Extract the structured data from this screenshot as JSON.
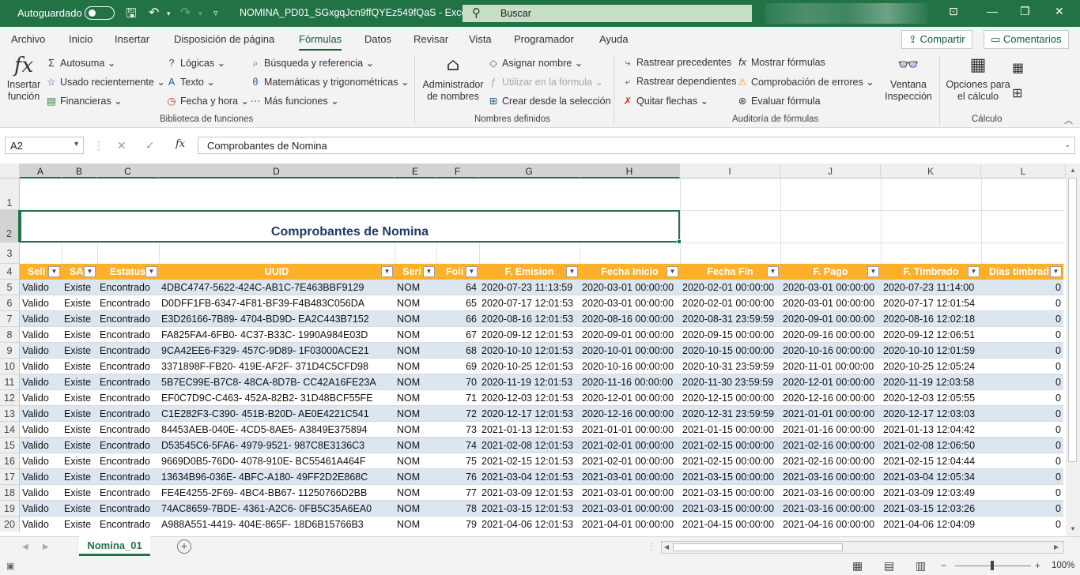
{
  "titlebar": {
    "autosave_label": "Autoguardado",
    "doc_title": "NOMINA_PD01_SGxgqJcn9ffQYEz549fQaS  -  Excel",
    "search_label": "Buscar"
  },
  "menu": {
    "items": [
      "Archivo",
      "Inicio",
      "Insertar",
      "Disposición de página",
      "Fórmulas",
      "Datos",
      "Revisar",
      "Vista",
      "Programador",
      "Ayuda"
    ],
    "active": "Fórmulas",
    "share": "Compartir",
    "comments": "Comentarios"
  },
  "ribbon": {
    "insert_function": "Insertar función",
    "autosum": "Autosuma",
    "recent": "Usado recientemente",
    "financial": "Financieras",
    "logical": "Lógicas",
    "text": "Texto",
    "datetime": "Fecha y hora",
    "lookup": "Búsqueda y referencia",
    "math": "Matemáticas y trigonométricas",
    "more": "Más funciones",
    "group1": "Biblioteca de funciones",
    "name_manager": "Administrador de nombres",
    "define_name": "Asignar nombre",
    "use_in_formula": "Utilizar en la fórmula",
    "create_from_sel": "Crear desde la selección",
    "group2": "Nombres definidos",
    "trace_prec": "Rastrear precedentes",
    "trace_dep": "Rastrear dependientes",
    "remove_arrows": "Quitar flechas",
    "show_formulas": "Mostrar fórmulas",
    "error_check": "Comprobación de errores",
    "evaluate": "Evaluar fórmula",
    "group3": "Auditoría de fórmulas",
    "watch": "Ventana Inspección",
    "calc_options": "Opciones para el cálculo",
    "group4": "Cálculo"
  },
  "formula_bar": {
    "name_box": "A2",
    "formula": "Comprobantes de Nomina"
  },
  "sheet": {
    "columns": [
      "A",
      "B",
      "C",
      "D",
      "E",
      "F",
      "G",
      "H",
      "I",
      "J",
      "K",
      "L"
    ],
    "title": "Comprobantes de Nomina",
    "headers": [
      "Sell",
      "SA",
      "Estatus",
      "UUID",
      "Seri",
      "Foli",
      "F. Emision",
      "Fecha Inicio",
      "Fecha Fin",
      "F. Pago",
      "F. Timbrado",
      "Días timbrad"
    ],
    "rows": [
      {
        "n": "5",
        "a": "Valido",
        "b": "Existe",
        "c": "Encontrado",
        "d": "4DBC4747-5622-424C-AB1C-7E463BBF9129",
        "e": "NOM",
        "f": "64",
        "g": "2020-07-23 11:13:59",
        "h": "2020-03-01 00:00:00",
        "i": "2020-02-01 00:00:00",
        "j": "2020-03-01 00:00:00",
        "k": "2020-07-23 11:14:00",
        "l": "0"
      },
      {
        "n": "6",
        "a": "Valido",
        "b": "Existe",
        "c": "Encontrado",
        "d": "D0DFF1FB-6347-4F81-BF39-F4B483C056DA",
        "e": "NOM",
        "f": "65",
        "g": "2020-07-17 12:01:53",
        "h": "2020-03-01 00:00:00",
        "i": "2020-02-01 00:00:00",
        "j": "2020-03-01 00:00:00",
        "k": "2020-07-17 12:01:54",
        "l": "0"
      },
      {
        "n": "7",
        "a": "Valido",
        "b": "Existe",
        "c": "Encontrado",
        "d": "E3D26166-7B89- 4704-BD9D- EA2C443B7152",
        "e": "NOM",
        "f": "66",
        "g": "2020-08-16 12:01:53",
        "h": "2020-08-16 00:00:00",
        "i": "2020-08-31 23:59:59",
        "j": "2020-09-01 00:00:00",
        "k": "2020-08-16 12:02:18",
        "l": "0"
      },
      {
        "n": "8",
        "a": "Valido",
        "b": "Existe",
        "c": "Encontrado",
        "d": "FA825FA4-6FB0- 4C37-B33C- 1990A984E03D",
        "e": "NOM",
        "f": "67",
        "g": "2020-09-12 12:01:53",
        "h": "2020-09-01 00:00:00",
        "i": "2020-09-15 00:00:00",
        "j": "2020-09-16 00:00:00",
        "k": "2020-09-12 12:06:51",
        "l": "0"
      },
      {
        "n": "9",
        "a": "Valido",
        "b": "Existe",
        "c": "Encontrado",
        "d": "9CA42EE6-F329- 457C-9D89- 1F03000ACE21",
        "e": "NOM",
        "f": "68",
        "g": "2020-10-10 12:01:53",
        "h": "2020-10-01 00:00:00",
        "i": "2020-10-15 00:00:00",
        "j": "2020-10-16 00:00:00",
        "k": "2020-10-10 12:01:59",
        "l": "0"
      },
      {
        "n": "10",
        "a": "Valido",
        "b": "Existe",
        "c": "Encontrado",
        "d": "3371898F-FB20- 419E-AF2F- 371D4C5CFD98",
        "e": "NOM",
        "f": "69",
        "g": "2020-10-25 12:01:53",
        "h": "2020-10-16 00:00:00",
        "i": "2020-10-31 23:59:59",
        "j": "2020-11-01 00:00:00",
        "k": "2020-10-25 12:05:24",
        "l": "0"
      },
      {
        "n": "11",
        "a": "Valido",
        "b": "Existe",
        "c": "Encontrado",
        "d": "5B7EC99E-B7C8- 48CA-8D7B- CC42A16FE23A",
        "e": "NOM",
        "f": "70",
        "g": "2020-11-19 12:01:53",
        "h": "2020-11-16 00:00:00",
        "i": "2020-11-30 23:59:59",
        "j": "2020-12-01 00:00:00",
        "k": "2020-11-19 12:03:58",
        "l": "0"
      },
      {
        "n": "12",
        "a": "Valido",
        "b": "Existe",
        "c": "Encontrado",
        "d": "EF0C7D9C-C463- 452A-82B2- 31D48BCF55FE",
        "e": "NOM",
        "f": "71",
        "g": "2020-12-03 12:01:53",
        "h": "2020-12-01 00:00:00",
        "i": "2020-12-15 00:00:00",
        "j": "2020-12-16 00:00:00",
        "k": "2020-12-03 12:05:55",
        "l": "0"
      },
      {
        "n": "13",
        "a": "Valido",
        "b": "Existe",
        "c": "Encontrado",
        "d": "C1E282F3-C390- 451B-B20D- AE0E4221C541",
        "e": "NOM",
        "f": "72",
        "g": "2020-12-17 12:01:53",
        "h": "2020-12-16 00:00:00",
        "i": "2020-12-31 23:59:59",
        "j": "2021-01-01 00:00:00",
        "k": "2020-12-17 12:03:03",
        "l": "0"
      },
      {
        "n": "14",
        "a": "Valido",
        "b": "Existe",
        "c": "Encontrado",
        "d": "84453AEB-040E- 4CD5-8AE5- A3849E375894",
        "e": "NOM",
        "f": "73",
        "g": "2021-01-13 12:01:53",
        "h": "2021-01-01 00:00:00",
        "i": "2021-01-15 00:00:00",
        "j": "2021-01-16 00:00:00",
        "k": "2021-01-13 12:04:42",
        "l": "0"
      },
      {
        "n": "15",
        "a": "Valido",
        "b": "Existe",
        "c": "Encontrado",
        "d": "D53545C6-5FA6- 4979-9521- 987C8E3136C3",
        "e": "NOM",
        "f": "74",
        "g": "2021-02-08 12:01:53",
        "h": "2021-02-01 00:00:00",
        "i": "2021-02-15 00:00:00",
        "j": "2021-02-16 00:00:00",
        "k": "2021-02-08 12:06:50",
        "l": "0"
      },
      {
        "n": "16",
        "a": "Valido",
        "b": "Existe",
        "c": "Encontrado",
        "d": "9669D0B5-76D0- 4078-910E- BC55461A464F",
        "e": "NOM",
        "f": "75",
        "g": "2021-02-15 12:01:53",
        "h": "2021-02-01 00:00:00",
        "i": "2021-02-15 00:00:00",
        "j": "2021-02-16 00:00:00",
        "k": "2021-02-15 12:04:44",
        "l": "0"
      },
      {
        "n": "17",
        "a": "Valido",
        "b": "Existe",
        "c": "Encontrado",
        "d": "13634B96-036E- 4BFC-A180- 49FF2D2E868C",
        "e": "NOM",
        "f": "76",
        "g": "2021-03-04 12:01:53",
        "h": "2021-03-01 00:00:00",
        "i": "2021-03-15 00:00:00",
        "j": "2021-03-16 00:00:00",
        "k": "2021-03-04 12:05:34",
        "l": "0"
      },
      {
        "n": "18",
        "a": "Valido",
        "b": "Existe",
        "c": "Encontrado",
        "d": "FE4E4255-2F69- 4BC4-BB67- 11250766D2BB",
        "e": "NOM",
        "f": "77",
        "g": "2021-03-09 12:01:53",
        "h": "2021-03-01 00:00:00",
        "i": "2021-03-15 00:00:00",
        "j": "2021-03-16 00:00:00",
        "k": "2021-03-09 12:03:49",
        "l": "0"
      },
      {
        "n": "19",
        "a": "Valido",
        "b": "Existe",
        "c": "Encontrado",
        "d": "74AC8659-7BDE- 4361-A2C6- 0FB5C35A6EA0",
        "e": "NOM",
        "f": "78",
        "g": "2021-03-15 12:01:53",
        "h": "2021-03-01 00:00:00",
        "i": "2021-03-15 00:00:00",
        "j": "2021-03-16 00:00:00",
        "k": "2021-03-15 12:03:26",
        "l": "0"
      },
      {
        "n": "20",
        "a": "Valido",
        "b": "Existe",
        "c": "Encontrado",
        "d": "A988A551-4419- 404E-865F- 18D6B15766B3",
        "e": "NOM",
        "f": "79",
        "g": "2021-04-06 12:01:53",
        "h": "2021-04-01 00:00:00",
        "i": "2021-04-15 00:00:00",
        "j": "2021-04-16 00:00:00",
        "k": "2021-04-06 12:04:09",
        "l": "0"
      }
    ]
  },
  "sheet_tab": "Nomina_01",
  "status": {
    "zoom": "100%"
  },
  "colors": {
    "accent": "#217346",
    "header_fill": "#ffb029",
    "band_fill": "#dce6f1",
    "title_text": "#1f3864"
  }
}
